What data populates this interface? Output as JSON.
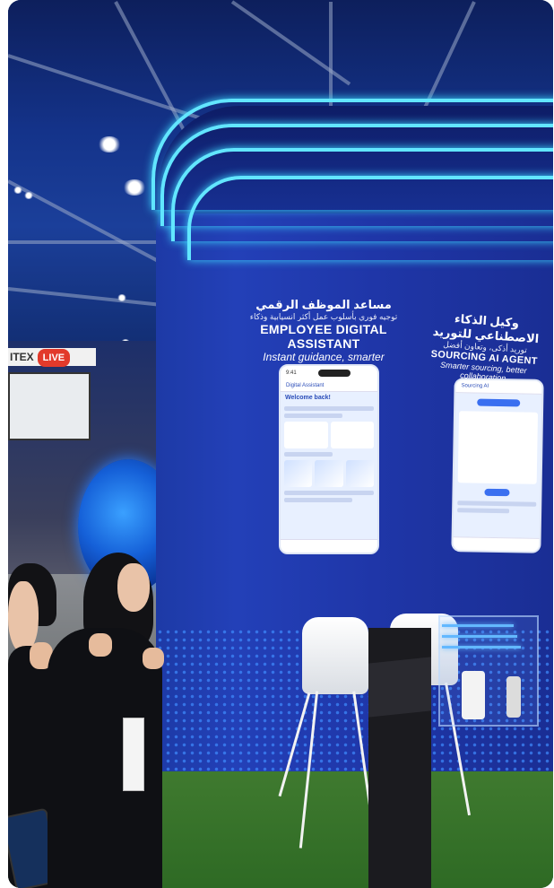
{
  "hall": {
    "banner_text": "ITEX",
    "banner_badge": "LIVE"
  },
  "booth": {
    "left_sign": {
      "arabic_title": "مساعد الموظف الرقمي",
      "arabic_subtitle": "توجيه فوري بأسلوب عمل أكثر انسيابية وذكاء",
      "english_title": "EMPLOYEE DIGITAL ASSISTANT",
      "english_subtitle": "Instant guidance, smarter workflow"
    },
    "right_sign": {
      "arabic_title": "وكيل الذكاء الاصطناعي للتوريد",
      "arabic_subtitle": "توريد أذكى، وتعاون أفضل",
      "english_title": "SOURCING AI AGENT",
      "english_subtitle": "Smarter sourcing, better collaboration"
    },
    "accent_color": "#62e6ff",
    "wall_color": "#2340b8"
  },
  "phone_left": {
    "time": "9:41",
    "app_title": "Digital Assistant",
    "greeting": "Welcome back!"
  },
  "phone_right": {
    "app_title": "Sourcing AI"
  }
}
